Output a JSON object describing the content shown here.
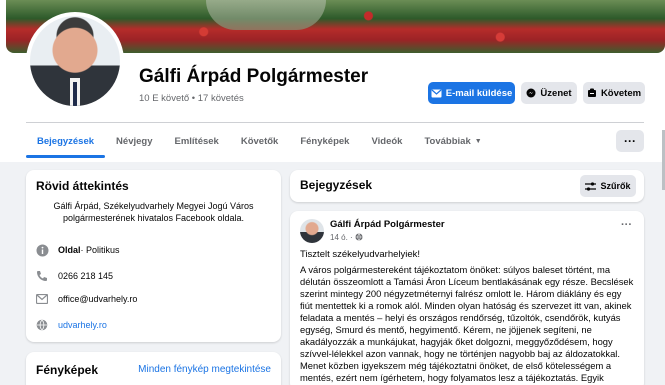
{
  "profile": {
    "name": "Gálfi Árpád Polgármester",
    "stats": "10 E követő • 17 követés"
  },
  "actions": {
    "email": "E-mail küldése",
    "message": "Üzenet",
    "follow": "Követem"
  },
  "tabs": [
    "Bejegyzések",
    "Névjegy",
    "Említések",
    "Követők",
    "Fényképek",
    "Videók",
    "Továbbiak"
  ],
  "intro": {
    "title": "Rövid áttekintés",
    "description": "Gálfi Árpád, Székelyudvarhely Megyei Jogú Város polgármesterének hivatalos Facebook oldala.",
    "category_label": "Oldal",
    "category_value": " · Politikus",
    "phone": "0266 218 145",
    "email": "office@udvarhely.ro",
    "website": "udvarhely.ro"
  },
  "photos": {
    "title": "Fényképek",
    "see_all": "Minden fénykép megtekintése"
  },
  "posts": {
    "title": "Bejegyzések",
    "filter": "Szűrők"
  },
  "post": {
    "author": "Gálfi Árpád Polgármester",
    "date": "14 ó. · ",
    "greeting": "Tisztelt székelyudvarhelyiek!",
    "body": "A város polgármestereként tájékoztatom önöket: súlyos baleset történt, ma délután összeomlott a Tamási Áron Líceum bentlakásának egy része. Becslések szerint mintegy 200 négyzetméternyi falrész omlott le. Három diáklány és egy fiút mentettek ki a romok alól. Minden olyan hatóság és szervezet itt van, akinek feladata a mentés – helyi és országos rendőrség, tűzoltók, csendőrök, kutyás egység, Smurd és mentő, hegyimentő. Kérem, ne jöjjenek segíteni, ne akadályozzák a munkájukat, hagyják őket dolgozni, meggyőződésem, hogy szívvel-lélekkel azon vannak, hogy ne történjen nagyobb baj az áldozatokkal. Menet közben igyekszem még tájékoztatni önöket, de első kötelességem a mentés, ezért nem ígérhetem, hogy folyamatos lesz a tájékoztatás. Egyik kolléganőm gondolatát tolmácsolom,"
  },
  "colors": {
    "accent": "#1b74e4",
    "background": "#f0f2f5"
  }
}
